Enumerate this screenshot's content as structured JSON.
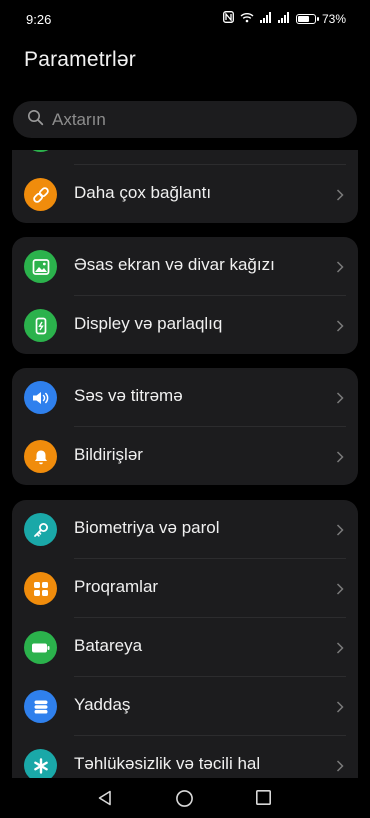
{
  "status_bar": {
    "time": "9:26",
    "battery_percent": "73%",
    "battery_level": 0.73,
    "icons": [
      "nfc-icon",
      "wifi-icon",
      "signal-icon",
      "signal-icon",
      "battery-icon"
    ]
  },
  "page": {
    "title": "Parametrlər"
  },
  "search": {
    "placeholder": "Axtarın"
  },
  "groups": [
    {
      "items": [
        {
          "label": "",
          "icon": "partial-green-icon",
          "color": "#2bb24c"
        },
        {
          "label": "Daha çox bağlantı",
          "icon": "link-icon",
          "color": "#f08c0c"
        }
      ]
    },
    {
      "items": [
        {
          "label": "Əsas ekran və divar kağızı",
          "icon": "image-icon",
          "color": "#2bb24c"
        },
        {
          "label": "Displey və parlaqlıq",
          "icon": "phone-brightness-icon",
          "color": "#2bb24c"
        }
      ]
    },
    {
      "items": [
        {
          "label": "Səs və titrəmə",
          "icon": "speaker-icon",
          "color": "#2f80ed"
        },
        {
          "label": "Bildirişlər",
          "icon": "bell-icon",
          "color": "#f08c0c"
        }
      ]
    },
    {
      "items": [
        {
          "label": "Biometriya və parol",
          "icon": "key-icon",
          "color": "#1aa8a8"
        },
        {
          "label": "Proqramlar",
          "icon": "apps-grid-icon",
          "color": "#f08c0c"
        },
        {
          "label": "Batareya",
          "icon": "battery-icon",
          "color": "#2bb24c"
        },
        {
          "label": "Yaddaş",
          "icon": "storage-icon",
          "color": "#2f80ed"
        },
        {
          "label": "Təhlükəsizlik və təcili hal",
          "icon": "asterisk-icon",
          "color": "#1aa8a8"
        }
      ]
    }
  ],
  "nav": {
    "buttons": [
      "back-icon",
      "home-icon",
      "recents-icon"
    ]
  },
  "colors": {
    "background": "#000000",
    "card": "#1c1c1e",
    "text": "#f0f0f0",
    "muted": "#8d8d8d"
  }
}
